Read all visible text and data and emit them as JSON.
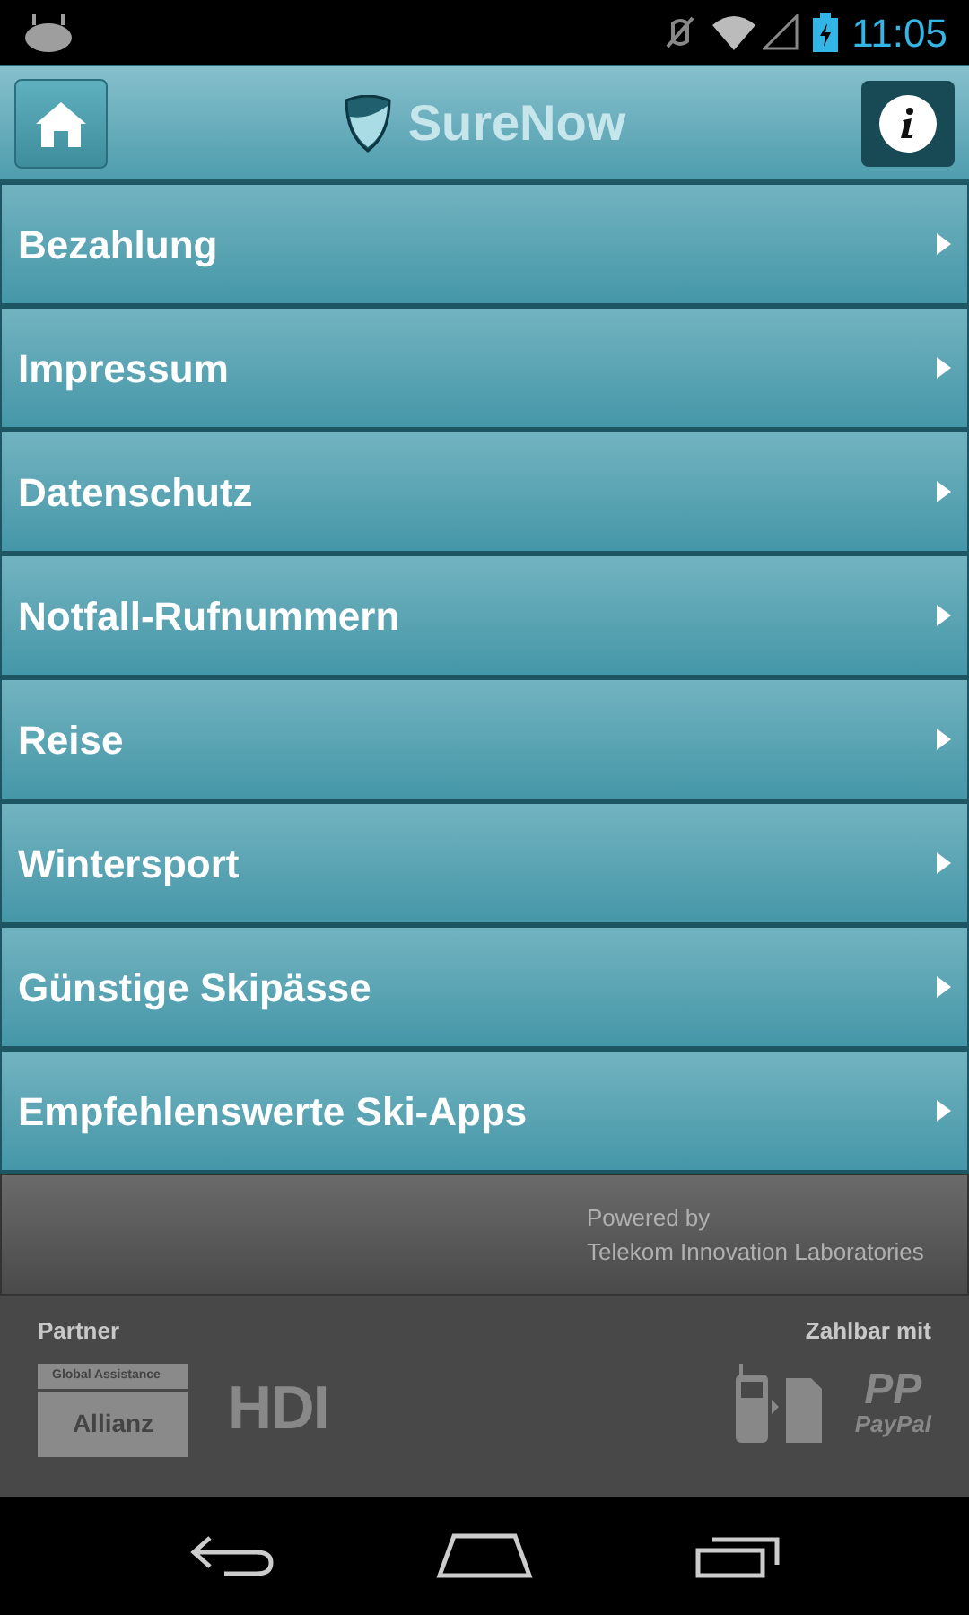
{
  "status_bar": {
    "time": "11:05"
  },
  "header": {
    "title": "SureNow"
  },
  "menu": [
    {
      "label": "Bezahlung"
    },
    {
      "label": "Impressum"
    },
    {
      "label": "Datenschutz"
    },
    {
      "label": "Notfall-Rufnummern"
    },
    {
      "label": "Reise"
    },
    {
      "label": "Wintersport"
    },
    {
      "label": "Günstige Skipässe"
    },
    {
      "label": "Empfehlenswerte Ski-Apps"
    }
  ],
  "powered_by": {
    "line_1": "Powered by",
    "line_2": "Telekom Innovation Laboratories"
  },
  "partners": {
    "label": "Partner",
    "allianz_top": "Global Assistance",
    "allianz_name": "Allianz",
    "hdi": "HDI"
  },
  "payment": {
    "label": "Zahlbar mit",
    "paypal_mark": "PP",
    "paypal_name": "PayPal"
  }
}
